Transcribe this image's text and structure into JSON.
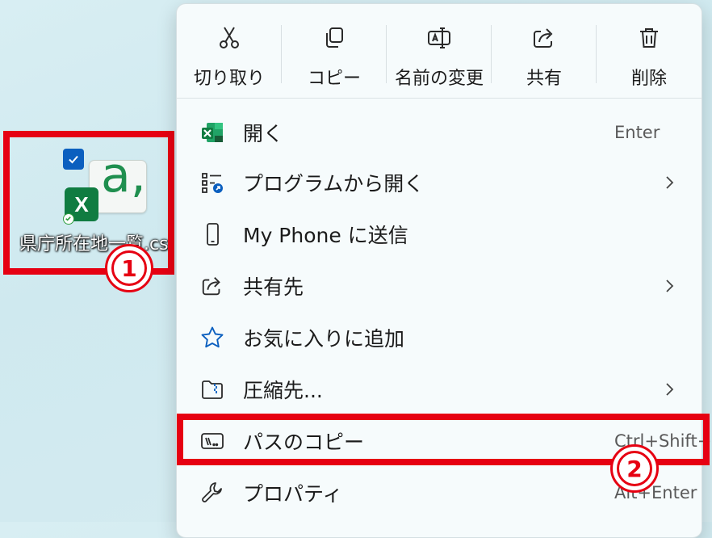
{
  "desktop_file": {
    "name": "県庁所在地一覧.csv",
    "doc_letter": "a,",
    "app_letter": "X"
  },
  "callouts": {
    "one": "1",
    "two": "2"
  },
  "toolbar": [
    {
      "label": "切り取り",
      "icon": "scissors-icon"
    },
    {
      "label": "コピー",
      "icon": "copy-icon"
    },
    {
      "label": "名前の変更",
      "icon": "rename-icon"
    },
    {
      "label": "共有",
      "icon": "share-icon"
    },
    {
      "label": "削除",
      "icon": "trash-icon"
    }
  ],
  "menu": [
    {
      "label": "開く",
      "shortcut": "Enter",
      "icon": "excel-icon"
    },
    {
      "label": "プログラムから開く",
      "shortcut": "",
      "icon": "open-with-icon",
      "submenu": true
    },
    {
      "label": "My Phone に送信",
      "shortcut": "",
      "icon": "phone-icon"
    },
    {
      "label": "共有先",
      "shortcut": "",
      "icon": "share-icon",
      "submenu": true
    },
    {
      "label": "お気に入りに追加",
      "shortcut": "",
      "icon": "star-icon"
    },
    {
      "label": "圧縮先...",
      "shortcut": "",
      "icon": "zip-folder-icon",
      "submenu": true
    },
    {
      "label": "パスのコピー",
      "shortcut": "Ctrl+Shift+C",
      "icon": "copy-path-icon"
    },
    {
      "label": "プロパティ",
      "shortcut": "Alt+Enter",
      "icon": "wrench-icon"
    }
  ],
  "colors": {
    "highlight": "#e60012",
    "accent": "#0b5fbf",
    "excel": "#107c41"
  }
}
